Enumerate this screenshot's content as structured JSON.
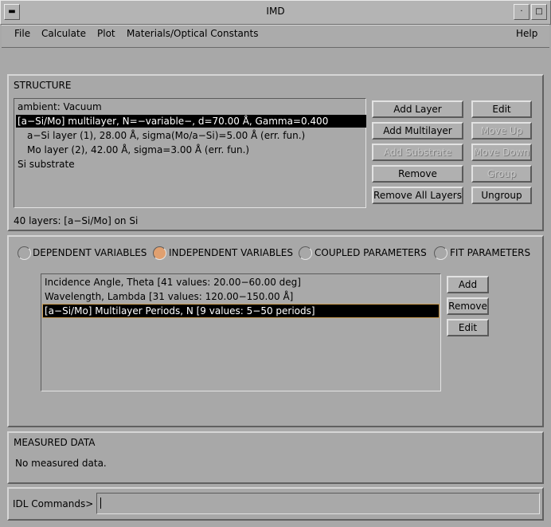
{
  "window": {
    "title": "IMD"
  },
  "menubar": {
    "file": "File",
    "calculate": "Calculate",
    "plot": "Plot",
    "materials": "Materials/Optical Constants",
    "help": "Help"
  },
  "structure": {
    "header": "STRUCTURE",
    "items": [
      "ambient: Vacuum",
      "[a−Si/Mo] multilayer, N=−variable−, d=70.00 Å, Gamma=0.400",
      "a−Si layer (1), 28.00 Å, sigma(Mo/a−Si)=5.00 Å (err. fun.)",
      "Mo layer (2), 42.00 Å, sigma=3.00 Å (err. fun.)",
      "Si substrate"
    ],
    "summary": "40 layers: [a−Si/Mo] on Si",
    "buttons": {
      "add_layer": "Add Layer",
      "edit": "Edit",
      "add_multilayer": "Add Multilayer",
      "move_up": "Move Up",
      "add_substrate": "Add Substrate",
      "move_down": "Move Down",
      "remove": "Remove",
      "group": "Group",
      "remove_all": "Remove All Layers",
      "ungroup": "Ungroup"
    }
  },
  "variables": {
    "tabs": {
      "dependent": "DEPENDENT VARIABLES",
      "independent": "INDEPENDENT VARIABLES",
      "coupled": "COUPLED PARAMETERS",
      "fit": "FIT PARAMETERS"
    },
    "selected_tab": "independent",
    "items": [
      "Incidence Angle, Theta [41 values: 20.00−60.00 deg]",
      "Wavelength, Lambda [31 values: 120.00−150.00 Å]",
      "[a−Si/Mo] Multilayer Periods, N [9 values: 5−50 periods]"
    ],
    "buttons": {
      "add": "Add",
      "remove": "Remove",
      "edit": "Edit"
    }
  },
  "measured": {
    "header": "MEASURED DATA",
    "status": "No measured data."
  },
  "idl": {
    "label": "IDL Commands>",
    "value": ""
  },
  "colors": {
    "background": "#a8a8a8",
    "selection": "#000000",
    "radio_on": "#e0a070"
  }
}
